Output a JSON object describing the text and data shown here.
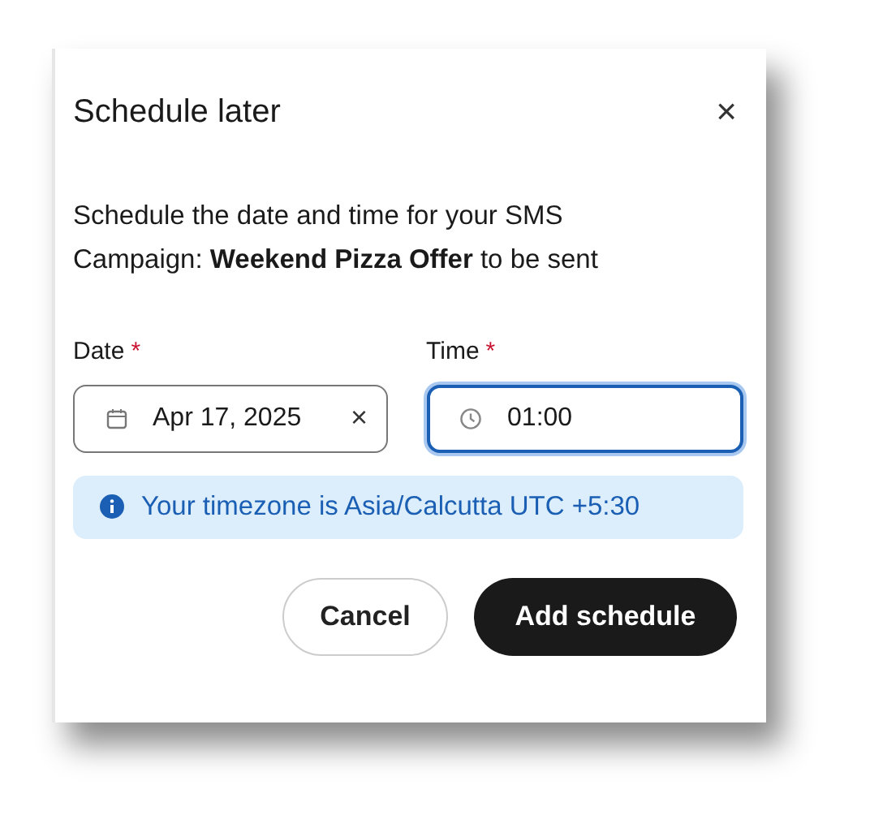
{
  "dialog": {
    "title": "Schedule later",
    "close": "×",
    "message": "Schedule the date and time for your SMS Campaign: **Weekend Pizza Offer** to be sent",
    "fields": [
      {
        "kind": "date",
        "label": "Date",
        "required_mark": "*",
        "value": "Apr 17, 2025",
        "clear": "×",
        "focused": false
      },
      {
        "kind": "time",
        "label": "Time",
        "required_mark": "*",
        "value": "01:00",
        "focused": true
      }
    ],
    "info": "Your timezone is Asia/Calcutta UTC +5:30",
    "buttons": [
      {
        "kind": "secondary",
        "label": "Cancel"
      },
      {
        "kind": "primary",
        "label": "Add schedule"
      }
    ]
  }
}
